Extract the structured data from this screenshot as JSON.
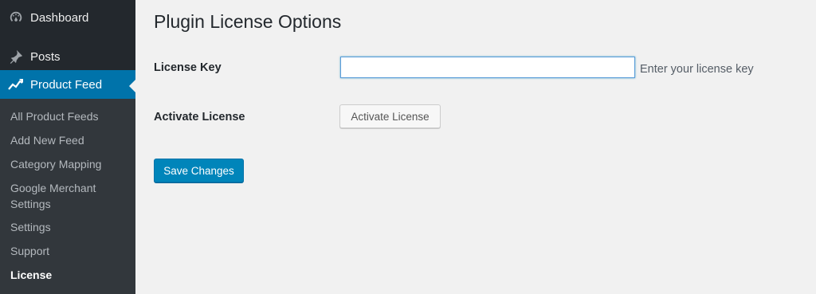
{
  "sidebar": {
    "menu": [
      {
        "label": "Dashboard",
        "icon": "dashboard-icon"
      },
      {
        "label": "Posts",
        "icon": "pin-icon"
      },
      {
        "label": "Product Feed",
        "icon": "chart-line-icon",
        "current": true
      }
    ],
    "submenu": [
      {
        "label": "All Product Feeds"
      },
      {
        "label": "Add New Feed"
      },
      {
        "label": "Category Mapping"
      },
      {
        "label": "Google Merchant Settings"
      },
      {
        "label": "Settings"
      },
      {
        "label": "Support"
      },
      {
        "label": "License",
        "current": true
      }
    ]
  },
  "page": {
    "title": "Plugin License Options",
    "license_key_label": "License Key",
    "license_key_value": "",
    "license_key_description": "Enter your license key",
    "activate_label": "Activate License",
    "activate_button": "Activate License",
    "save_button": "Save Changes"
  },
  "colors": {
    "sidebar_bg": "#23282d",
    "submenu_bg": "#32373c",
    "accent": "#0073aa",
    "primary_button": "#0085ba",
    "page_bg": "#f1f1f1"
  }
}
